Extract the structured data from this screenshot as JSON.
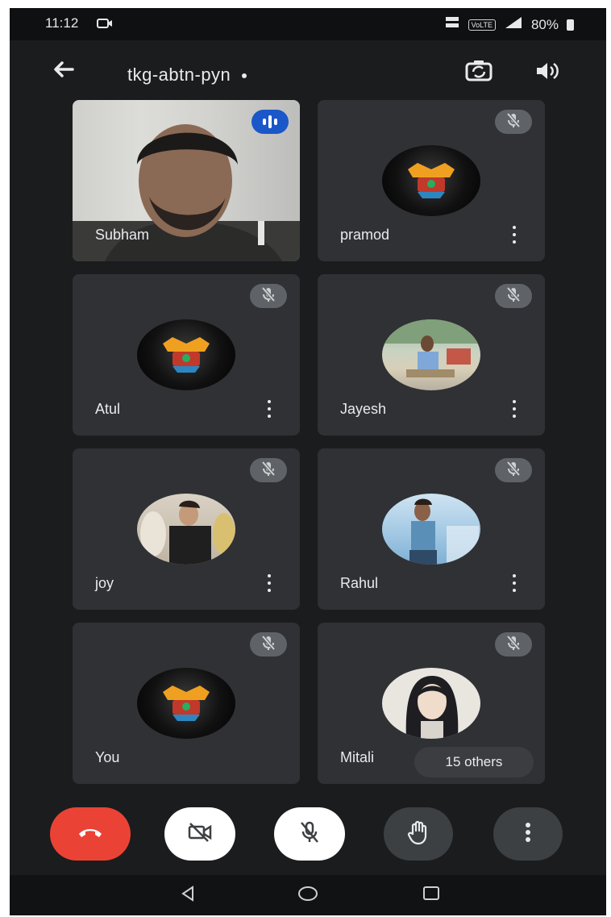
{
  "status_bar": {
    "time": "11:12",
    "data_badge": "VoLTE",
    "battery_percent": "80%"
  },
  "header": {
    "meeting_code": "tkg-abtn-pyn"
  },
  "tiles": [
    {
      "name": "Subham",
      "state": "video",
      "speaking": true
    },
    {
      "name": "pramod",
      "state": "logo-avatar",
      "mic_muted": true
    },
    {
      "name": "Atul",
      "state": "logo-avatar",
      "mic_muted": true
    },
    {
      "name": "Jayesh",
      "state": "photo-avatar",
      "mic_muted": true
    },
    {
      "name": "joy",
      "state": "photo-avatar",
      "mic_muted": true
    },
    {
      "name": "Rahul",
      "state": "photo-avatar",
      "mic_muted": true
    },
    {
      "name": "You",
      "state": "logo-avatar",
      "mic_muted": true
    },
    {
      "name": "Mitali",
      "state": "photo-avatar",
      "mic_muted": true
    }
  ],
  "others_chip": "15 others",
  "controls": {
    "end_call_icon": "phone-hangup-icon",
    "camera_icon": "video-off-icon",
    "mic_icon": "mic-off-icon",
    "hand_icon": "raise-hand-icon",
    "more_icon": "more-vertical-icon"
  },
  "colors": {
    "background": "#1b1c1e",
    "tile": "#303134",
    "end_call": "#ea4335",
    "speaking": "#1a57c9"
  }
}
